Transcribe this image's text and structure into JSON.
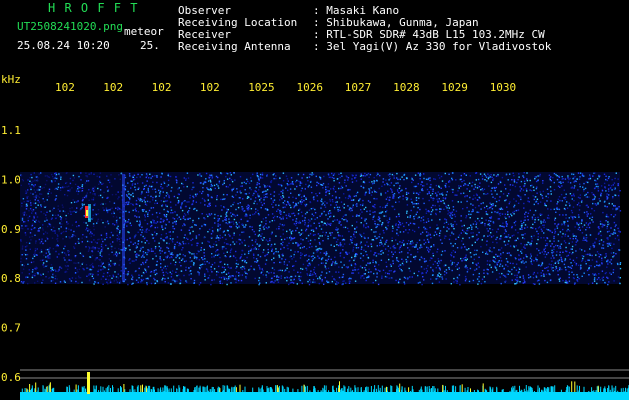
{
  "header": {
    "brand": "H R O F F T",
    "filename": "UT2508241020.png",
    "kind": "meteor",
    "timestamp": "25.08.24 10:20",
    "extra": "25.",
    "info": [
      {
        "label": "Observer",
        "value": ": Masaki Kano"
      },
      {
        "label": "Receiving Location",
        "value": ": Shibukawa, Gunma, Japan"
      },
      {
        "label": "Receiver",
        "value": ": RTL-SDR SDR# 43dB L15 103.2MHz CW"
      },
      {
        "label": "Receiving Antenna",
        "value": ": 3el Yagi(V) Az 330 for Vladivostok"
      }
    ]
  },
  "axis": {
    "unit": "kHz",
    "x_ticks": [
      "102",
      "102",
      "102",
      "102",
      "1025",
      "1026",
      "1027",
      "1028",
      "1029",
      "1030"
    ],
    "y_ticks": [
      "1.1",
      "1.0",
      "0.9",
      "0.8",
      "0.7",
      "0.6"
    ]
  },
  "colors": {
    "header_green": "#22dd55",
    "text_white": "#ffffff",
    "label_yellow": "#ffee33",
    "noise_blue": "#1a2adf",
    "baseline_cyan": "#00d8ff"
  }
}
